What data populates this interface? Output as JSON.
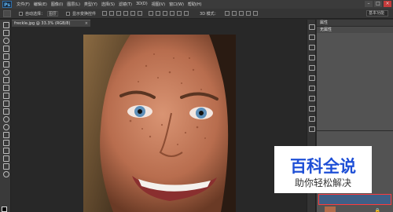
{
  "app": {
    "logo": "Ps",
    "menu": [
      "文件(F)",
      "编辑(E)",
      "图像(I)",
      "图层(L)",
      "类型(Y)",
      "选择(S)",
      "滤镜(T)",
      "3D(D)",
      "视图(V)",
      "窗口(W)",
      "帮助(H)"
    ],
    "window_controls": [
      "–",
      "□",
      "×"
    ]
  },
  "options": {
    "auto_select_label": "自动选择：",
    "auto_select_value": "图层",
    "transform_label": "显示变换控件",
    "mode_3d_label": "3D 模式：",
    "workspace": "基本功能"
  },
  "document": {
    "tab_label": "freckle.jpg @ 33.3% (RGB/8)",
    "close": "×"
  },
  "panels": {
    "properties_tab": "属性",
    "properties_sub": "无属性"
  },
  "watermark": {
    "title": "百科全说",
    "subtitle": "助你轻松解决"
  },
  "icons": {
    "lock": "lock-icon"
  }
}
